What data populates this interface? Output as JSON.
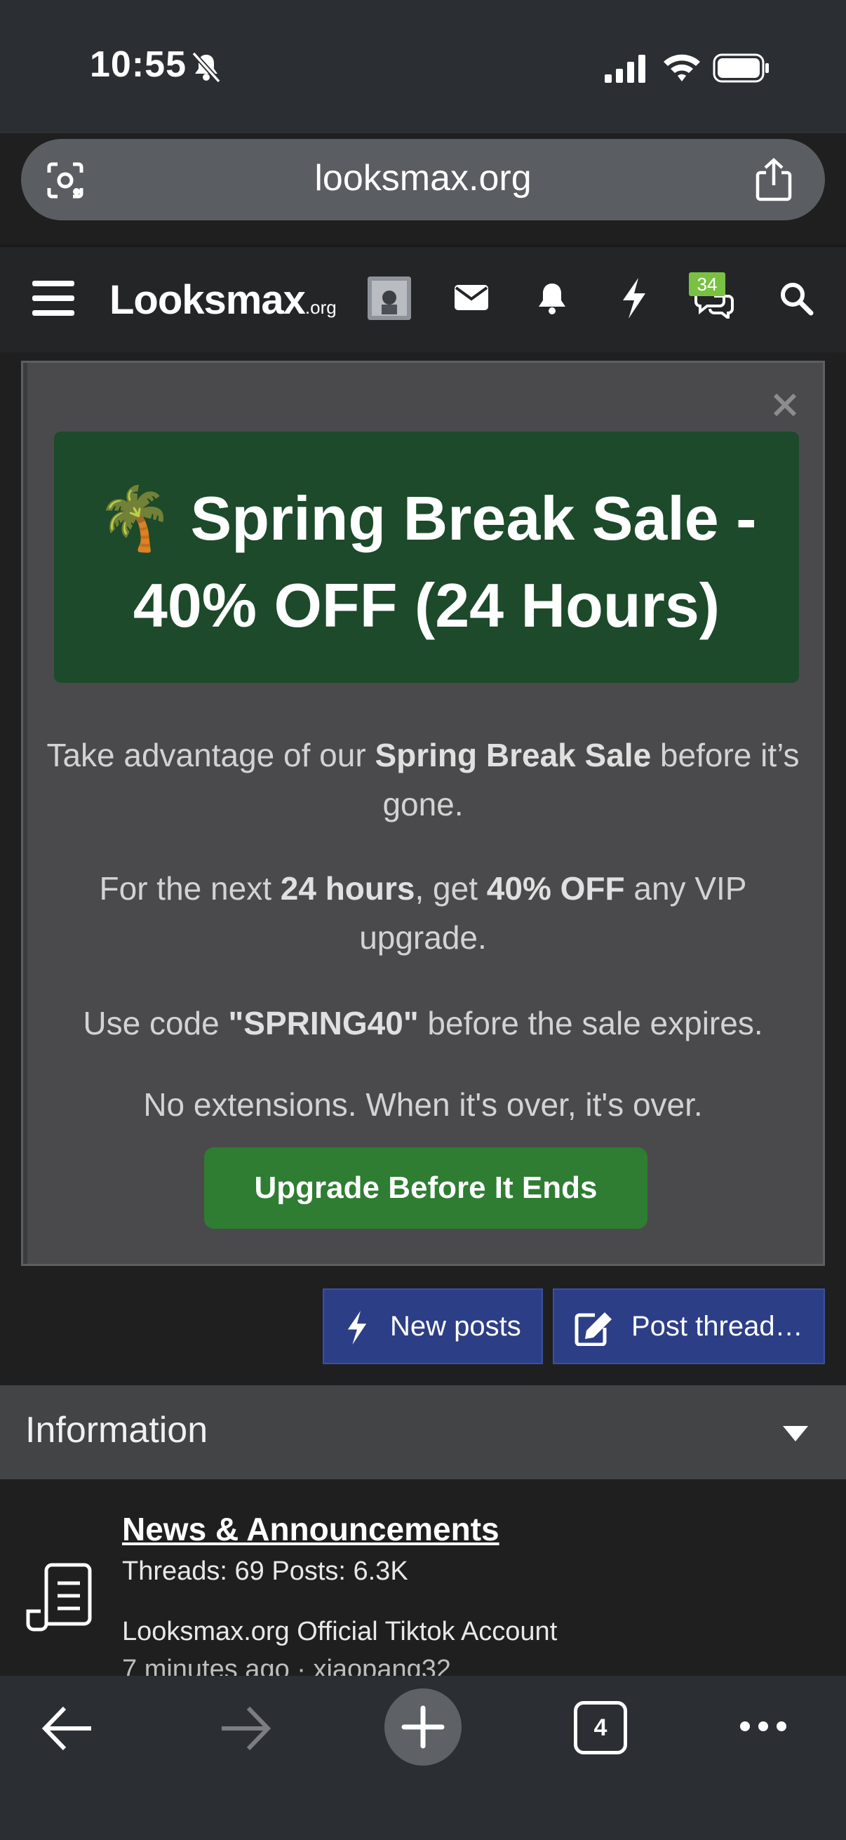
{
  "status_bar": {
    "time": "10:55"
  },
  "browser": {
    "url": "looksmax.org",
    "open_tabs": "4"
  },
  "header": {
    "logo_main": "Looksmax",
    "logo_suffix": ".org",
    "conversations_badge": "34"
  },
  "promo": {
    "emoji": "🌴",
    "title": "Spring Break Sale - 40% OFF (24 Hours)",
    "p1_a": "Take advantage of our ",
    "p1_b": "Spring Break Sale",
    "p1_c": " before it’s gone.",
    "p2_a": "For the next ",
    "p2_b": "24 hours",
    "p2_c": ", get ",
    "p2_d": "40% OFF",
    "p2_e": " any VIP upgrade.",
    "p3_a": "Use code ",
    "p3_b": "\"SPRING40\"",
    "p3_c": " before the sale expires.",
    "p4": "No extensions. When it's over, it's over.",
    "cta_label": "Upgrade Before It Ends"
  },
  "actions": {
    "new_posts": "New posts",
    "post_thread": "Post thread…"
  },
  "section": {
    "title": "Information",
    "forum": {
      "name": "News & Announcements",
      "stats": "Threads: 69 Posts: 6.3K",
      "latest_thread": "Looksmax.org Official Tiktok Account",
      "latest_meta": "7 minutes ago · xiaopang32"
    }
  }
}
